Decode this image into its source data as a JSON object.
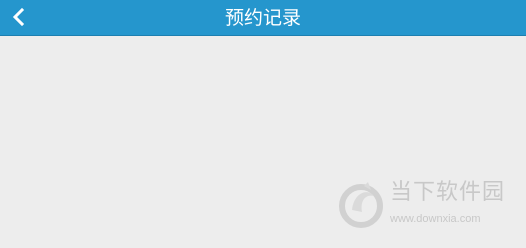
{
  "header": {
    "title": "预约记录",
    "back_icon": "chevron-left-icon",
    "background_color": "#2596cd",
    "title_color": "#ffffff"
  },
  "content": {
    "background_color": "#ededed"
  },
  "watermark": {
    "logo_icon": "downxia-logo-icon",
    "name": "当下软件园",
    "url": "www.downxia.com"
  }
}
